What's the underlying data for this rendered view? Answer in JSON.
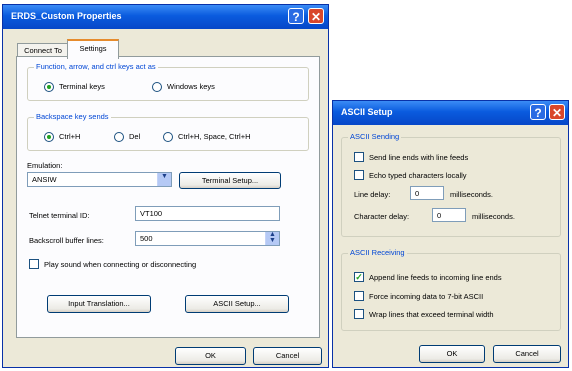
{
  "main_dialog": {
    "title": "ERDS_Custom Properties",
    "tabs": [
      "Connect To",
      "Settings"
    ],
    "function_keys": {
      "group_label": "Function, arrow, and ctrl keys act as",
      "options": [
        "Terminal keys",
        "Windows keys"
      ],
      "selected": "Terminal keys"
    },
    "backspace": {
      "group_label": "Backspace key sends",
      "options": [
        "Ctrl+H",
        "Del",
        "Ctrl+H, Space, Ctrl+H"
      ],
      "selected": "Ctrl+H"
    },
    "emulation_label": "Emulation:",
    "emulation_value": "ANSIW",
    "terminal_setup_button": "Terminal Setup...",
    "telnet_id_label": "Telnet terminal ID:",
    "telnet_id_value": "VT100",
    "buffer_label": "Backscroll buffer lines:",
    "buffer_value": "500",
    "play_sound_label": "Play sound when connecting or disconnecting",
    "input_translation_button": "Input Translation...",
    "ascii_setup_button": "ASCII Setup...",
    "ok_button": "OK",
    "cancel_button": "Cancel"
  },
  "ascii_dialog": {
    "title": "ASCII Setup",
    "sending_group": "ASCII Sending",
    "send_line_ends": "Send line ends with line feeds",
    "echo_typed": "Echo typed characters locally",
    "line_delay_label": "Line delay:",
    "line_delay_value": "0",
    "line_delay_unit": "milliseconds.",
    "char_delay_label": "Character delay:",
    "char_delay_value": "0",
    "char_delay_unit": "milliseconds.",
    "receiving_group": "ASCII Receiving",
    "append_line_feeds": "Append line feeds to incoming line ends",
    "force_7bit": "Force incoming data to 7-bit ASCII",
    "wrap_lines": "Wrap lines that exceed terminal width",
    "ok_button": "OK",
    "cancel_button": "Cancel"
  },
  "icons": [
    "help-icon",
    "close-icon",
    "combo-arrow-icon",
    "spinner-icon",
    "check-icon"
  ],
  "colors": {
    "title_bar": "#0a5bde",
    "dialog_bg": "#ece9d8",
    "group_title": "#0046d5",
    "close_button": "#d9472b"
  }
}
